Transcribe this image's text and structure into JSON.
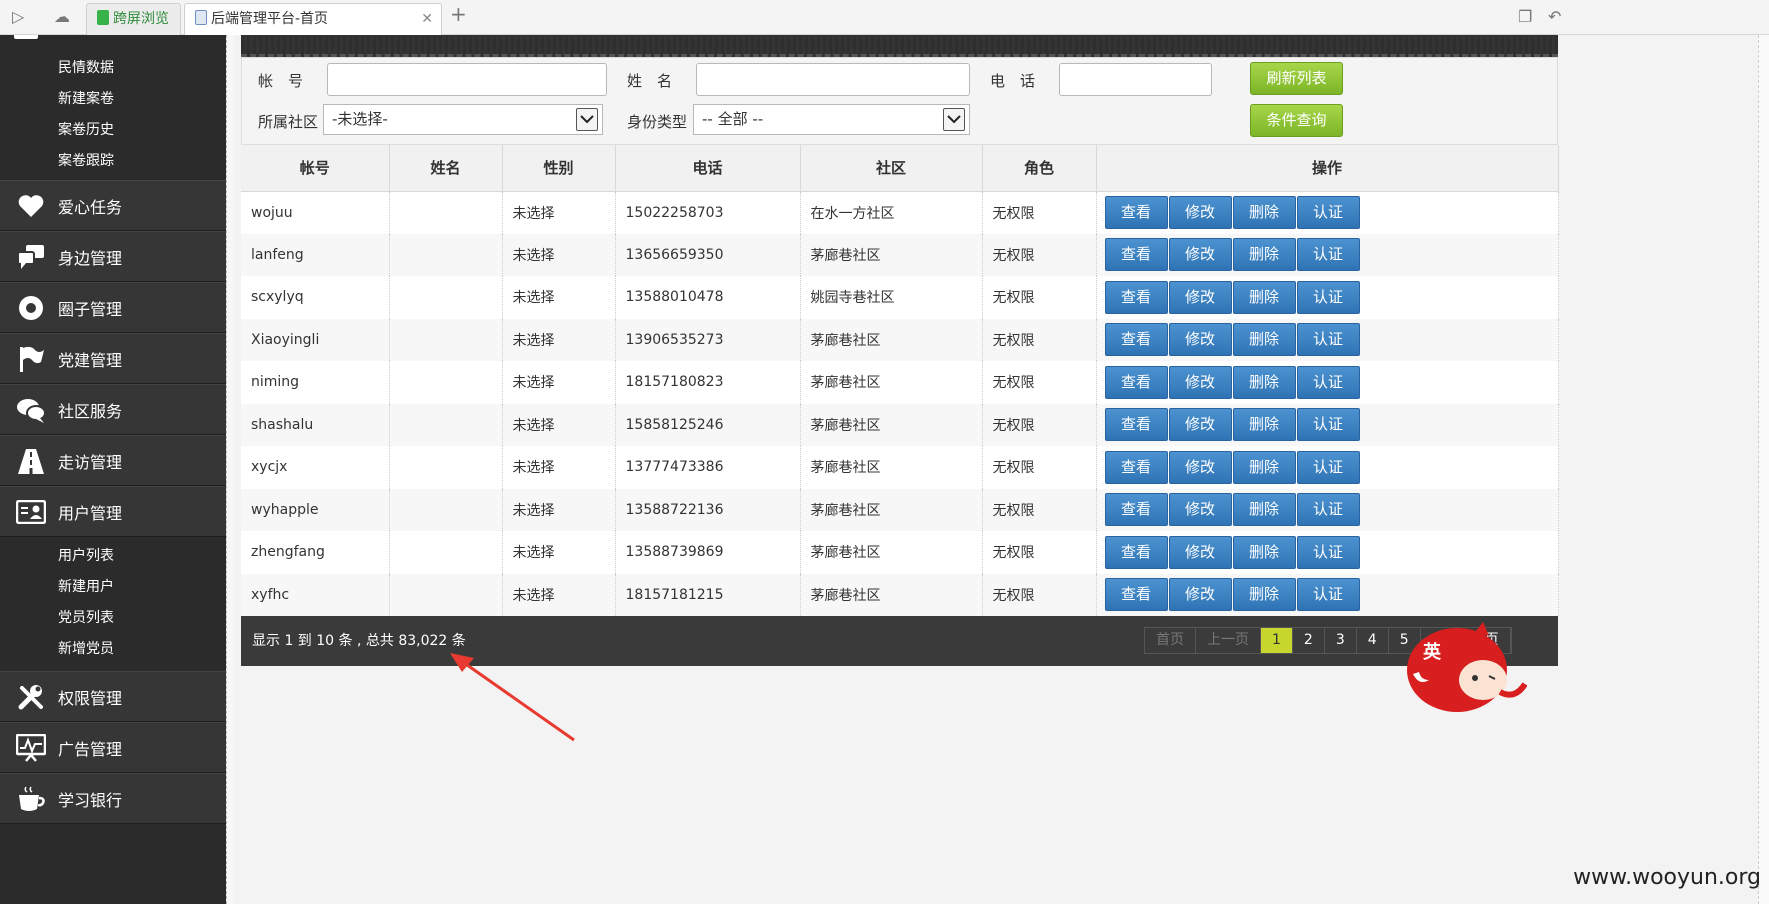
{
  "browser": {
    "tabs": [
      {
        "label": "跨屏浏览"
      },
      {
        "label": "后端管理平台-首页"
      }
    ]
  },
  "sidebar": {
    "top_sub": [
      "民情数据",
      "新建案卷",
      "案卷历史",
      "案卷跟踪"
    ],
    "menu": [
      {
        "label": "爱心任务",
        "icon": "heart-icon"
      },
      {
        "label": "身边管理",
        "icon": "chat-icon"
      },
      {
        "label": "圈子管理",
        "icon": "circle-icon"
      },
      {
        "label": "党建管理",
        "icon": "flag-icon"
      },
      {
        "label": "社区服务",
        "icon": "speech-bubbles-icon"
      },
      {
        "label": "走访管理",
        "icon": "road-icon"
      },
      {
        "label": "用户管理",
        "icon": "id-card-icon"
      }
    ],
    "user_sub": [
      "用户列表",
      "新建用户",
      "党员列表",
      "新增党员"
    ],
    "menu_bottom": [
      {
        "label": "权限管理",
        "icon": "tools-icon"
      },
      {
        "label": "广告管理",
        "icon": "monitor-chart-icon"
      },
      {
        "label": "学习银行",
        "icon": "coffee-cup-icon"
      }
    ]
  },
  "filter": {
    "account_label": "帐　号",
    "name_label": "姓　名",
    "phone_label": "电　话",
    "community_label": "所属社区",
    "community_value": "-未选择-",
    "identity_label": "身份类型",
    "identity_value": "-- 全部 --",
    "refresh_button": "刷新列表",
    "search_button": "条件查询"
  },
  "table": {
    "headers": [
      "帐号",
      "姓名",
      "性别",
      "电话",
      "社区",
      "角色",
      "操作"
    ],
    "actions": [
      "查看",
      "修改",
      "删除",
      "认证"
    ],
    "rows": [
      {
        "account": "wojuu",
        "name": "",
        "gender": "未选择",
        "phone": "15022258703",
        "community": "在水一方社区",
        "role": "无权限"
      },
      {
        "account": "lanfeng",
        "name": "",
        "gender": "未选择",
        "phone": "13656659350",
        "community": "茅廊巷社区",
        "role": "无权限"
      },
      {
        "account": "scxylyq",
        "name": "",
        "gender": "未选择",
        "phone": "13588010478",
        "community": "姚园寺巷社区",
        "role": "无权限"
      },
      {
        "account": "Xiaoyingli",
        "name": "",
        "gender": "未选择",
        "phone": "13906535273",
        "community": "茅廊巷社区",
        "role": "无权限"
      },
      {
        "account": "niming",
        "name": "",
        "gender": "未选择",
        "phone": "18157180823",
        "community": "茅廊巷社区",
        "role": "无权限"
      },
      {
        "account": "shashalu",
        "name": "",
        "gender": "未选择",
        "phone": "15858125246",
        "community": "茅廊巷社区",
        "role": "无权限"
      },
      {
        "account": "xycjx",
        "name": "",
        "gender": "未选择",
        "phone": "13777473386",
        "community": "茅廊巷社区",
        "role": "无权限"
      },
      {
        "account": "wyhapple",
        "name": "",
        "gender": "未选择",
        "phone": "13588722136",
        "community": "茅廊巷社区",
        "role": "无权限"
      },
      {
        "account": "zhengfang",
        "name": "",
        "gender": "未选择",
        "phone": "13588739869",
        "community": "茅廊巷社区",
        "role": "无权限"
      },
      {
        "account": "xyfhc",
        "name": "",
        "gender": "未选择",
        "phone": "18157181215",
        "community": "茅廊巷社区",
        "role": "无权限"
      }
    ]
  },
  "footer": {
    "info": "显示 1 到 10 条 , 总共 83,022 条",
    "pager": {
      "first": "首页",
      "prev": "上一页",
      "pages": [
        "1",
        "2",
        "3",
        "4",
        "5"
      ],
      "current": "1",
      "last": "末页"
    }
  },
  "mascot_label": "英",
  "watermark": "www.wooyun.org",
  "colors": {
    "sidebar_bg": "#2b2b2b",
    "green_button": "#8cc63f",
    "blue_button": "#3a7fc0",
    "pager_current": "#c6d62c",
    "arrow": "#e83a30"
  }
}
